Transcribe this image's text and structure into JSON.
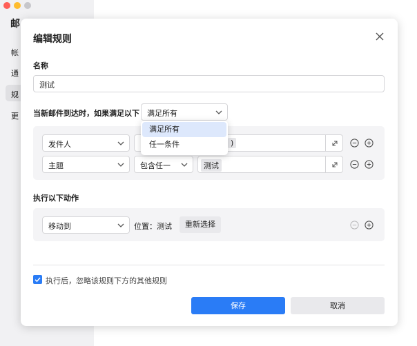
{
  "colors": {
    "accent": "#2a7cf6",
    "traffic_red": "#ff5f57",
    "traffic_yellow": "#febc2e",
    "traffic_gray": "#c7c7cb"
  },
  "background": {
    "title": "邮",
    "nav": [
      "帐",
      "通",
      "规",
      "更"
    ]
  },
  "dialog": {
    "title": "编辑规则",
    "name_label": "名称",
    "name_value": "测试",
    "condition_prefix": "当新邮件到达时，如果满足以下",
    "match_select": "满足所有",
    "match_options": [
      "满足所有",
      "任一条件"
    ],
    "conditions": [
      {
        "field": "发件人",
        "operator": "",
        "tag": ")"
      },
      {
        "field": "主题",
        "operator": "包含任一",
        "tag": "测试"
      }
    ],
    "actions_label": "执行以下动作",
    "action": {
      "type": "移动到",
      "location": "位置：测试",
      "reselect": "重新选择"
    },
    "skip_rules_label": "执行后，忽略该规则下方的其他规则",
    "save": "保存",
    "cancel": "取消"
  }
}
